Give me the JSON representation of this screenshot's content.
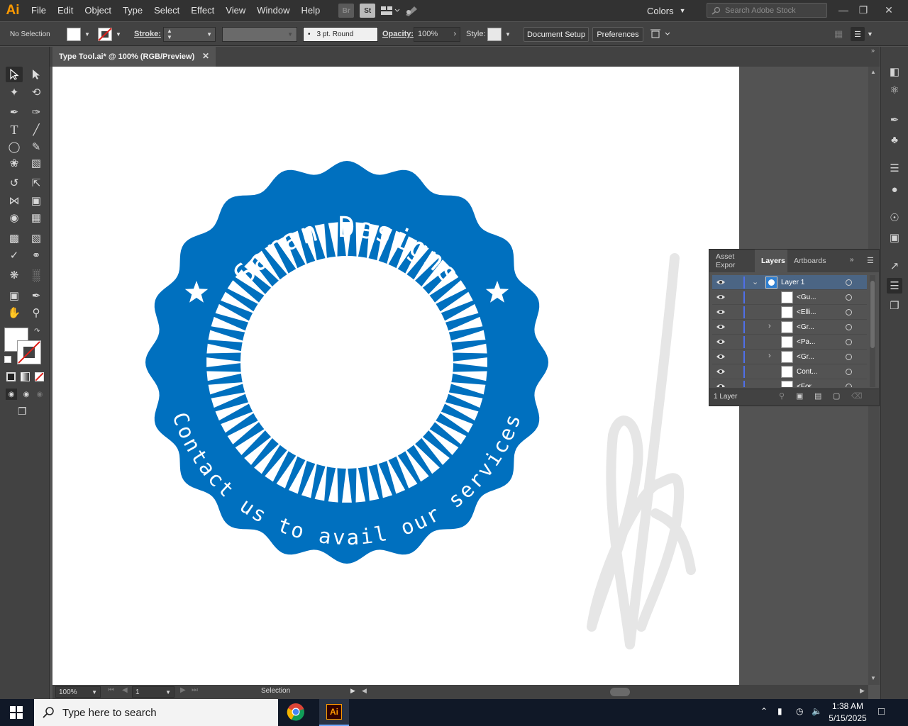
{
  "app": {
    "logo": "Ai"
  },
  "menubar": {
    "items": [
      "File",
      "Edit",
      "Object",
      "Type",
      "Select",
      "Effect",
      "View",
      "Window",
      "Help"
    ],
    "bridge_label": "Br",
    "stock_label": "St",
    "workspace": "Colors",
    "search_placeholder": "Search Adobe Stock"
  },
  "controlbar": {
    "selection": "No Selection",
    "stroke_label": "Stroke:",
    "brush": "3 pt. Round",
    "opacity_label": "Opacity:",
    "opacity_value": "100%",
    "style_label": "Style:",
    "document_setup": "Document Setup",
    "preferences": "Preferences"
  },
  "document": {
    "tab_title": "Type Tool.ai* @ 100% (RGB/Preview)"
  },
  "artwork": {
    "badge_color": "#0070bf",
    "top_text": "Saran Designs",
    "bottom_text": "Contact us to avail our services"
  },
  "statusbar": {
    "zoom": "100%",
    "artboard_num": "1",
    "tool": "Selection"
  },
  "layers_panel": {
    "tabs": [
      "Asset Expor",
      "Layers",
      "Artboards"
    ],
    "layer_count": "1 Layer",
    "rows": [
      {
        "name": "Layer 1",
        "expanded": true
      },
      {
        "name": "<Gu...",
        "expandable": false
      },
      {
        "name": "<Elli...",
        "expandable": false
      },
      {
        "name": "<Gr...",
        "expandable": true
      },
      {
        "name": "<Pa...",
        "expandable": false
      },
      {
        "name": "<Gr...",
        "expandable": true
      },
      {
        "name": "Cont...",
        "expandable": false
      },
      {
        "name": "<For...",
        "expandable": false
      }
    ]
  },
  "taskbar": {
    "search_placeholder": "Type here to search",
    "time": "1:38 AM",
    "date": "5/15/2025",
    "ai_label": "Ai"
  }
}
